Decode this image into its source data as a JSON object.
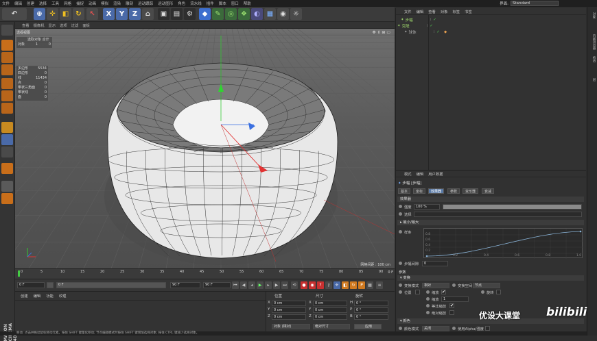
{
  "menubar": {
    "items": [
      "文件",
      "编辑",
      "创建",
      "选择",
      "工具",
      "网格",
      "捕捉",
      "动画",
      "模拟",
      "渲染",
      "雕刻",
      "运动跟踪",
      "运动图形",
      "角色",
      "流水线",
      "插件",
      "脚本",
      "窗口",
      "帮助"
    ],
    "layout_label": "界面:",
    "layout_value": "Standard"
  },
  "toolbar": {
    "axes": [
      "X",
      "Y",
      "Z"
    ]
  },
  "viewport": {
    "menu": [
      "查看",
      "摄像机",
      "显示",
      "选项",
      "过滤",
      "面板"
    ],
    "label": "透视视图",
    "hud_title": "选取对象 合计",
    "hud_rows": [
      [
        "对象",
        "1",
        "0"
      ]
    ],
    "stats": [
      [
        "多边形",
        "5534"
      ],
      [
        "四边形",
        "0"
      ],
      [
        "线",
        "11434"
      ],
      [
        "点",
        "0"
      ],
      [
        "带状三角面",
        "0"
      ],
      [
        "带状线",
        "0"
      ],
      [
        "面",
        "0"
      ]
    ],
    "scale": "网格间距 : 100 cm"
  },
  "timeline": {
    "ticks": [
      "0",
      "5",
      "10",
      "15",
      "20",
      "25",
      "30",
      "35",
      "40",
      "45",
      "50",
      "55",
      "60",
      "65",
      "70",
      "75",
      "80",
      "85",
      "90"
    ],
    "current": "0 F"
  },
  "controls": {
    "start": "0 F",
    "start2": "0 F",
    "end": "90 F",
    "end2": "90 F"
  },
  "material": {
    "menu": [
      "创建",
      "编辑",
      "功能",
      "纹理"
    ]
  },
  "coords": {
    "headers": [
      "位置",
      "尺寸",
      "旋转"
    ],
    "rows": [
      {
        "axis": "X",
        "pos": "0 cm",
        "size": "0 cm",
        "rotlabel": "H",
        "rot": "0 °"
      },
      {
        "axis": "Y",
        "pos": "0 cm",
        "size": "0 cm",
        "rotlabel": "P",
        "rot": "0 °"
      },
      {
        "axis": "Z",
        "pos": "0 cm",
        "size": "0 cm",
        "rotlabel": "B",
        "rot": "0 °"
      }
    ],
    "mode": "对象 (相对)",
    "size_mode": "绝对尺寸",
    "apply": "应用"
  },
  "objects": {
    "menu": [
      "文件",
      "编辑",
      "查看",
      "对象",
      "标签",
      "书签"
    ],
    "items": [
      {
        "name": "步幅",
        "color": "#9bd36a",
        "indent": 1
      },
      {
        "name": "克隆",
        "color": "#9bd36a",
        "indent": 0
      },
      {
        "name": "球体",
        "color": "#aaaaaa",
        "indent": 2
      }
    ]
  },
  "right_strip": [
    "对象",
    "内容浏览器",
    "构造",
    "层"
  ],
  "attributes": {
    "menu": [
      "模式",
      "编辑",
      "用户数据"
    ],
    "object_title": "步幅 [步幅]",
    "tabs": [
      "基本",
      "坐标",
      "效果器",
      "参数",
      "变形器",
      "衰减"
    ],
    "active_tab": "效果器",
    "section_effector": "效果器",
    "strength_label": "强度",
    "strength_value": "100 %",
    "select_label": "选择",
    "minmax_label": "最小/最大",
    "spline_label": "样条",
    "spline_x": [
      "0.2",
      "0.4",
      "0.6",
      "0.8",
      "1.0"
    ],
    "spline_y": [
      "0.8",
      "0.6",
      "0.4",
      "0.2"
    ],
    "step_gap_label": "步幅间隙",
    "step_gap_value": "0",
    "section_params": "参数",
    "section_transform": "变换",
    "transform_mode_label": "变换模式",
    "transform_mode_value": "相对",
    "transform_space_label": "变换空间",
    "transform_space_value": "节点",
    "pos_label": "位置",
    "scale_label": "缩放",
    "rot_label": "旋转",
    "uniform_label": "缩放",
    "uniform_value": "1",
    "equal_label": "等比缩放",
    "abs_label": "绝对缩放",
    "section_color": "颜色",
    "color_mode_label": "颜色模式",
    "color_mode_value": "关闭",
    "alpha_label": "使用Alpha/强度"
  },
  "watermark": {
    "text": "优设大课堂",
    "brand": "bilibili"
  },
  "logo": "MAXON CINEMA 4D",
  "status": "移动: 点击并拖动鼠标移动元素。按住 SHIFT 键量化移动; 节点编辑模式时按住 SHIFT 键增加选择对象; 按住 CTRL 键减少选择对象。"
}
